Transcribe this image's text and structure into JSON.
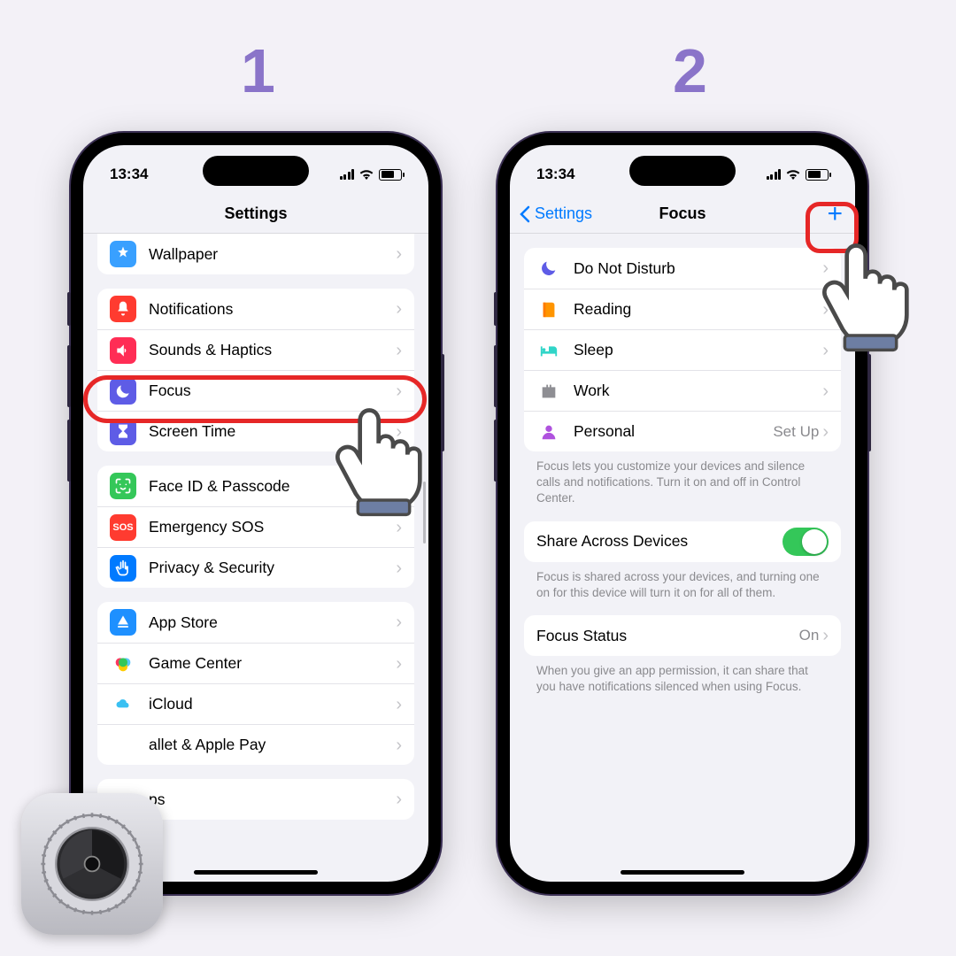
{
  "steps": {
    "one": "1",
    "two": "2"
  },
  "status_time": "13:34",
  "screen1": {
    "title": "Settings",
    "group_a": [
      {
        "label": "Wallpaper"
      }
    ],
    "group_b": [
      {
        "label": "Notifications"
      },
      {
        "label": "Sounds & Haptics"
      },
      {
        "label": "Focus"
      },
      {
        "label": "Screen Time"
      }
    ],
    "group_c": [
      {
        "label": "Face ID & Passcode"
      },
      {
        "label": "Emergency SOS"
      },
      {
        "label": "Privacy & Security"
      }
    ],
    "group_d": [
      {
        "label": "App Store"
      },
      {
        "label": "Game Center"
      },
      {
        "label": "iCloud"
      },
      {
        "label": "allet & Apple Pay"
      }
    ],
    "group_e": [
      {
        "label": "ps"
      }
    ]
  },
  "screen2": {
    "back": "Settings",
    "title": "Focus",
    "modes": [
      {
        "label": "Do Not Disturb"
      },
      {
        "label": "Reading"
      },
      {
        "label": "Sleep"
      },
      {
        "label": "Work"
      },
      {
        "label": "Personal",
        "detail": "Set Up"
      }
    ],
    "footer1": "Focus lets you customize your devices and silence calls and notifications. Turn it on and off in Control Center.",
    "share_row": {
      "label": "Share Across Devices"
    },
    "footer2": "Focus is shared across your devices, and turning one on for this device will turn it on for all of them.",
    "status_row": {
      "label": "Focus Status",
      "detail": "On"
    },
    "footer3": "When you give an app permission, it can share that you have notifications silenced when using Focus."
  }
}
